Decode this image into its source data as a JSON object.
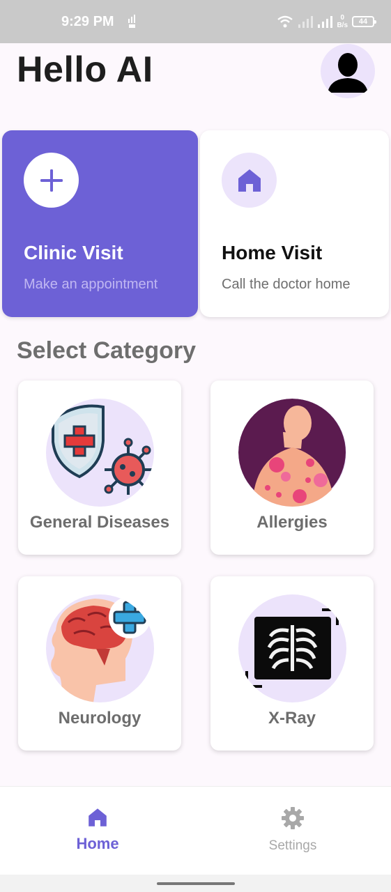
{
  "status_bar": {
    "time": "9:29 PM",
    "net_speed_value": "0",
    "net_speed_unit": "B/s",
    "battery": "44"
  },
  "header": {
    "greeting": "Hello AI"
  },
  "visits": [
    {
      "title": "Clinic Visit",
      "subtitle": "Make an appointment",
      "icon": "plus-icon"
    },
    {
      "title": "Home Visit",
      "subtitle": "Call the doctor home",
      "icon": "home-icon"
    }
  ],
  "section": {
    "title": "Select Category"
  },
  "categories": [
    {
      "label": "General Diseases",
      "icon": "shield-virus-icon"
    },
    {
      "label": "Allergies",
      "icon": "allergy-body-icon"
    },
    {
      "label": "Neurology",
      "icon": "brain-icon"
    },
    {
      "label": "X-Ray",
      "icon": "xray-icon"
    }
  ],
  "nav": {
    "home_label": "Home",
    "settings_label": "Settings"
  },
  "colors": {
    "accent": "#6d61d6",
    "light_accent": "#ece3fb",
    "text_muted": "#6e6e6e"
  }
}
